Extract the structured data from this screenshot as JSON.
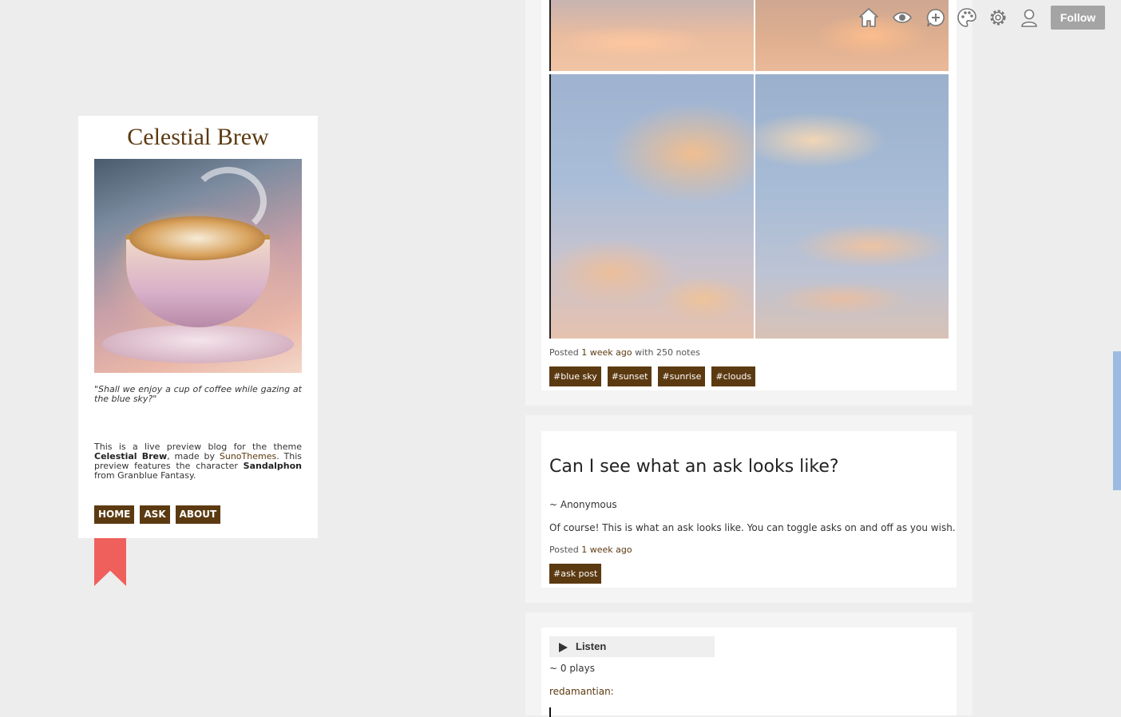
{
  "sidebar": {
    "title": "Celestial Brew",
    "quote": "\"Shall we enjoy a cup of coffee while gazing at the blue sky?\"",
    "description": {
      "part1": "This is a live preview blog for the theme ",
      "theme_name": "Celestial Brew",
      "part2": ", made by ",
      "author": "SunoThemes",
      "part3": ". This preview features the character ",
      "character": "Sandalphon",
      "part4": " from Granblue Fantasy."
    },
    "nav": [
      "HOME",
      "ASK",
      "ABOUT"
    ]
  },
  "photo_post": {
    "meta_prefix": "Posted ",
    "time": "1 week ago",
    "meta_suffix": " with 250 notes",
    "tags": [
      "#blue sky",
      "#sunset",
      "#sunrise",
      "#clouds"
    ]
  },
  "ask_post": {
    "title": "Can I see what an ask looks like?",
    "from": "~ Anonymous",
    "answer": "Of course! This is what an ask looks like. You can toggle asks on and off as you wish.",
    "meta_prefix": "Posted ",
    "time": "1 week ago",
    "tags": [
      "#ask post"
    ]
  },
  "audio_post": {
    "listen_label": "Listen",
    "plays": "~ 0 plays",
    "reblog_user": "redamantian:"
  },
  "top_controls": {
    "icons": [
      "home-icon",
      "eye-icon",
      "plus-bubble-icon",
      "palette-icon",
      "gear-icon",
      "user-icon"
    ],
    "follow_label": "Follow"
  },
  "colors": {
    "accent": "#5c3a11",
    "bookmark": "#ef605d",
    "background": "#ededed",
    "follow_button": "#a4a4a4"
  }
}
